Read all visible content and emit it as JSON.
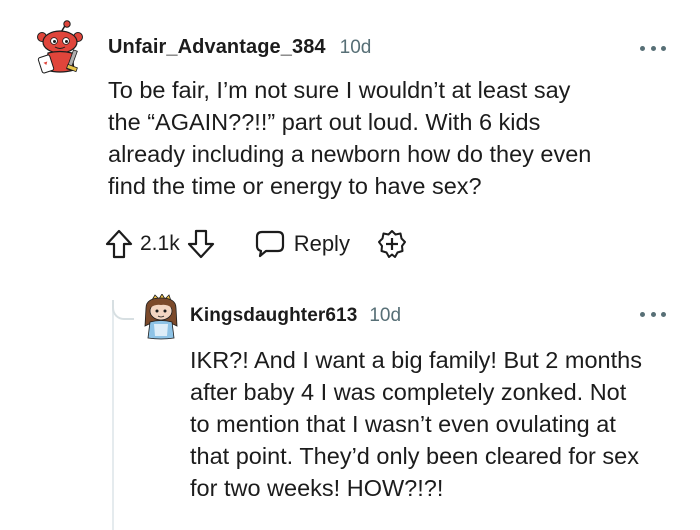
{
  "comments": [
    {
      "username": "Unfair_Advantage_384",
      "age": "10d",
      "body": "To be fair, I’m not sure I wouldn’t at least say\nthe “AGAIN??!!” part out loud. With 6 kids\nalready including a newborn how do they even\nfind the time or energy to have sex?",
      "votes": "2.1k",
      "reply_label": "Reply",
      "avatar_icon": "snoo-avatar-icon"
    },
    {
      "username": "Kingsdaughter613",
      "age": "10d",
      "body": "IKR?! And I want a big family! But 2 months\nafter baby 4 I was completely zonked. Not\nto mention that I wasn’t even ovulating at\nthat point. They’d only been cleared for sex\nfor two weeks! HOW?!?!",
      "avatar_icon": "snoo-avatar-icon"
    }
  ],
  "colors": {
    "text": "#1c1c1c",
    "meta": "#576f76",
    "thread_line": "#e5ebee",
    "avatar_red": "#e0453b"
  },
  "icons": {
    "upvote": "upvote-arrow-icon",
    "downvote": "downvote-arrow-icon",
    "reply": "speech-bubble-icon",
    "award": "award-plus-icon",
    "more": "ellipsis-icon"
  }
}
